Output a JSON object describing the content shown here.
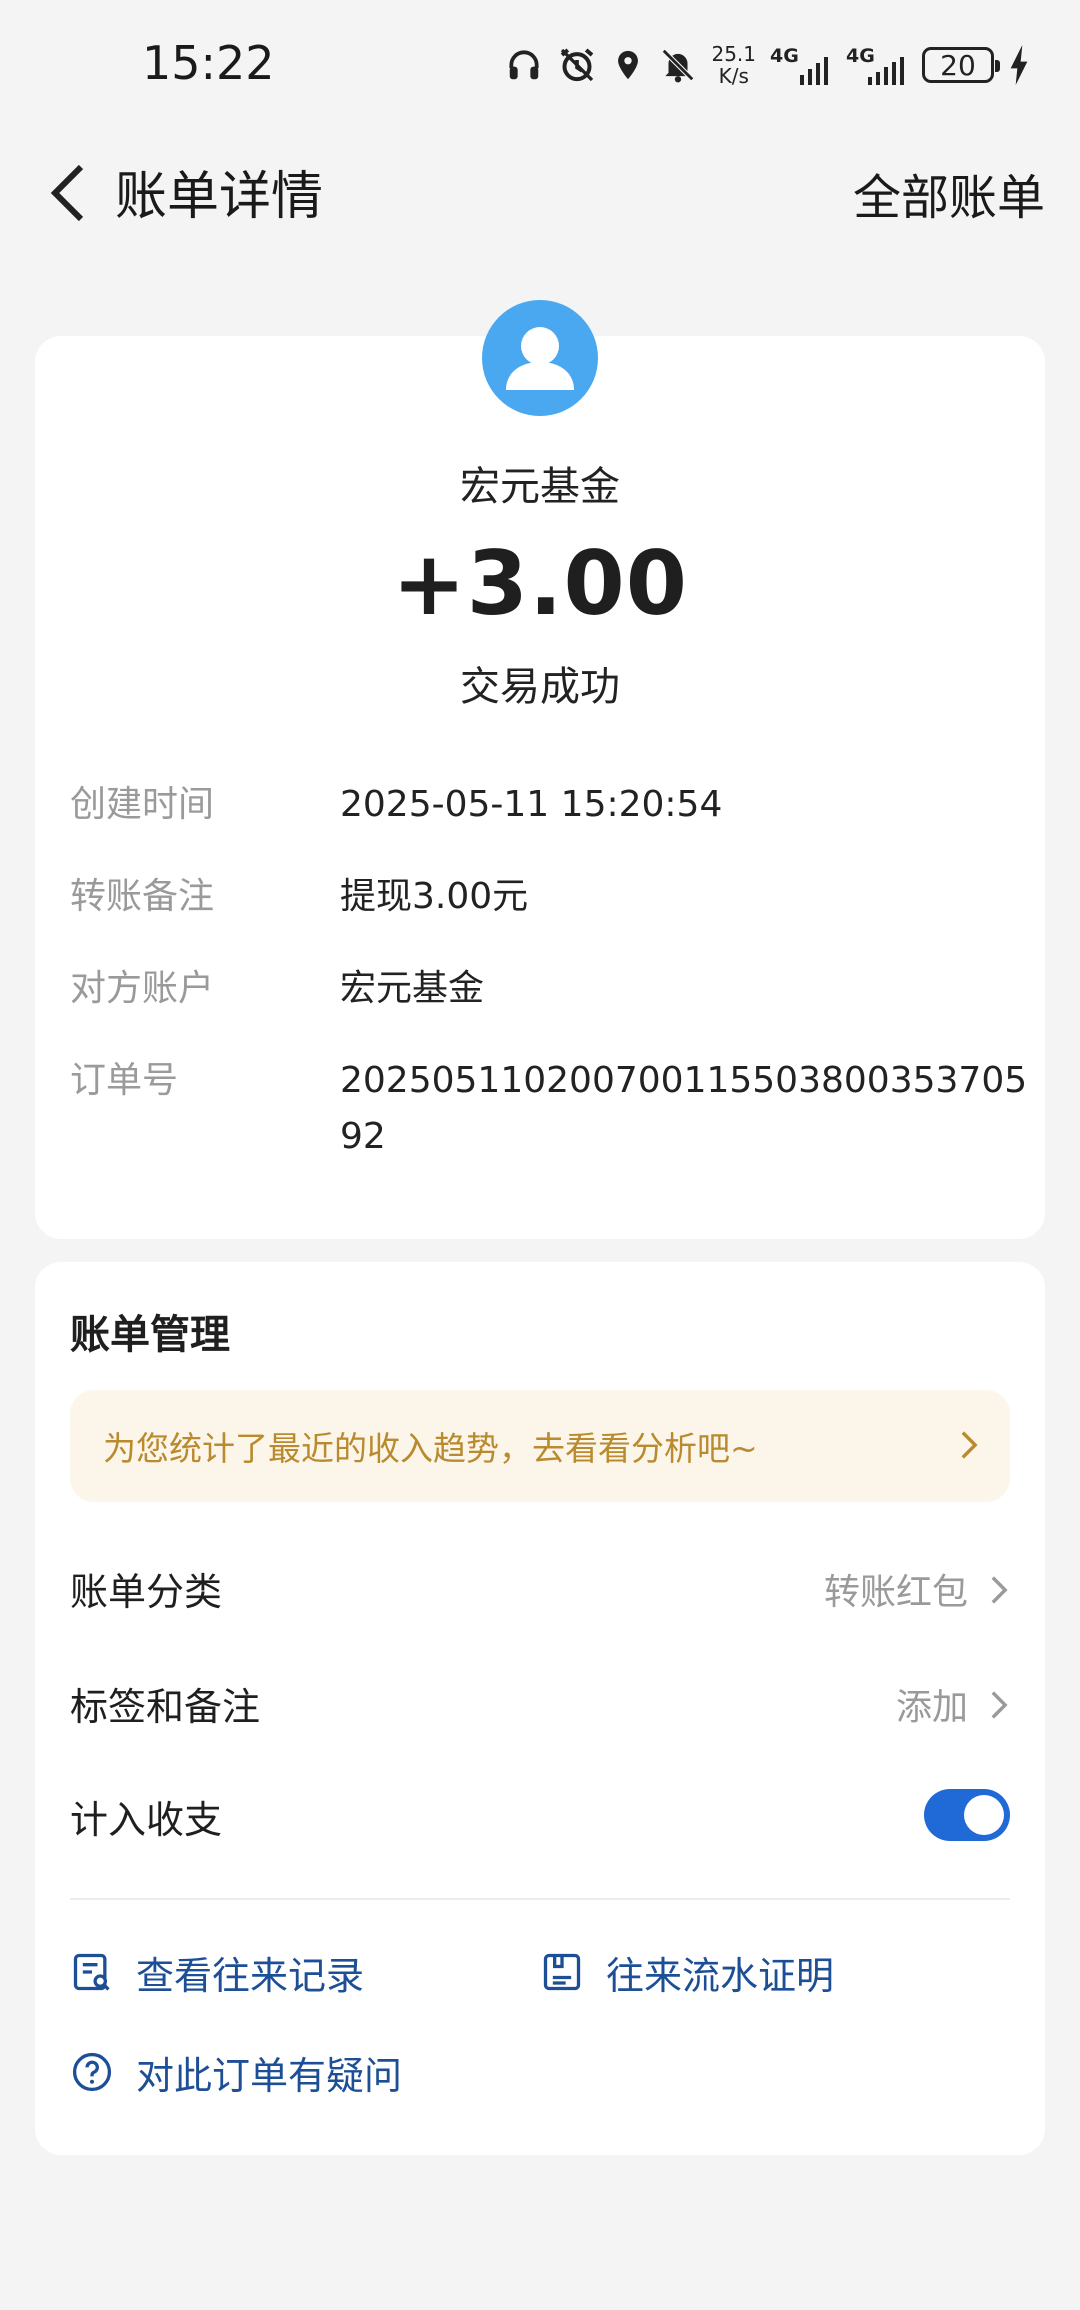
{
  "status_bar": {
    "time": "15:22",
    "net_speed_value": "25.1",
    "net_speed_unit": "K/s",
    "sim1_label": "4G",
    "sim2_label": "4G",
    "battery": "20"
  },
  "nav": {
    "title": "账单详情",
    "right_link": "全部账单"
  },
  "transaction": {
    "payee": "宏元基金",
    "amount": "+3.00",
    "status": "交易成功",
    "details": [
      {
        "key": "创建时间",
        "value": "2025-05-11 15:20:54"
      },
      {
        "key": "转账备注",
        "value": "提现3.00元"
      },
      {
        "key": "对方账户",
        "value": "宏元基金"
      },
      {
        "key": "订单号",
        "value": "20250511020070011550380035370592"
      }
    ]
  },
  "management": {
    "title": "账单管理",
    "tip": "为您统计了最近的收入趋势，去看看分析吧~",
    "category_label": "账单分类",
    "category_value": "转账红包",
    "tags_label": "标签和备注",
    "tags_value": "添加",
    "include_label": "计入收支",
    "include_enabled": true,
    "links": {
      "history": "查看往来记录",
      "statement": "往来流水证明",
      "question": "对此订单有疑问"
    }
  },
  "colors": {
    "accent_blue": "#1f6ad6",
    "link_blue": "#1d4f96",
    "tip_text": "#b98a2e",
    "tip_bg": "#fcf5ea",
    "avatar_bg": "#4aa8f0"
  }
}
